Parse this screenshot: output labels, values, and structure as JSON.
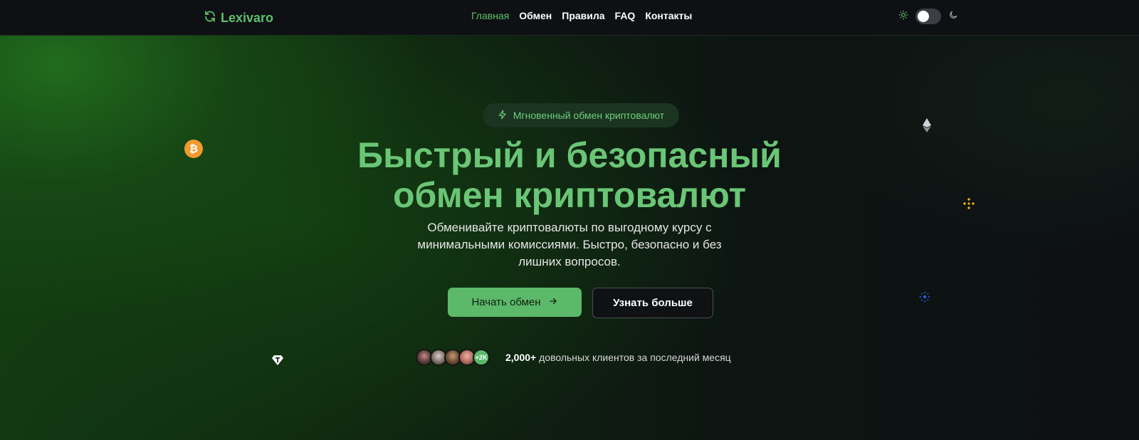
{
  "brand": {
    "name": "Lexivaro",
    "color": "#5cc16a"
  },
  "nav": {
    "items": [
      {
        "label": "Главная",
        "active": true
      },
      {
        "label": "Обмен",
        "active": false
      },
      {
        "label": "Правила",
        "active": false
      },
      {
        "label": "FAQ",
        "active": false
      },
      {
        "label": "Контакты",
        "active": false
      }
    ]
  },
  "theme": {
    "mode": "light",
    "icons": [
      "sun-icon",
      "moon-icon"
    ]
  },
  "hero": {
    "badge": "Мгновенный обмен криптовалют",
    "title_line1": "Быстрый и безопасный",
    "title_line2": "обмен криптовалют",
    "subtitle": "Обменивайте криптовалюты по выгодному курсу с минимальными комиссиями. Быстро, безопасно и без лишних вопросов.",
    "primary_button": "Начать обмен",
    "secondary_button": "Узнать больше"
  },
  "social_proof": {
    "plus_badge": "+2K",
    "count": "2,000+",
    "text": "довольных клиентов за последний месяц"
  },
  "floating_coins": [
    "bitcoin-icon",
    "ethereum-icon",
    "bnb-icon",
    "cardano-icon",
    "tether-icon"
  ],
  "colors": {
    "accent": "#5cb96a",
    "background": "#0d0f12",
    "bitcoin": "#f29a2e"
  }
}
